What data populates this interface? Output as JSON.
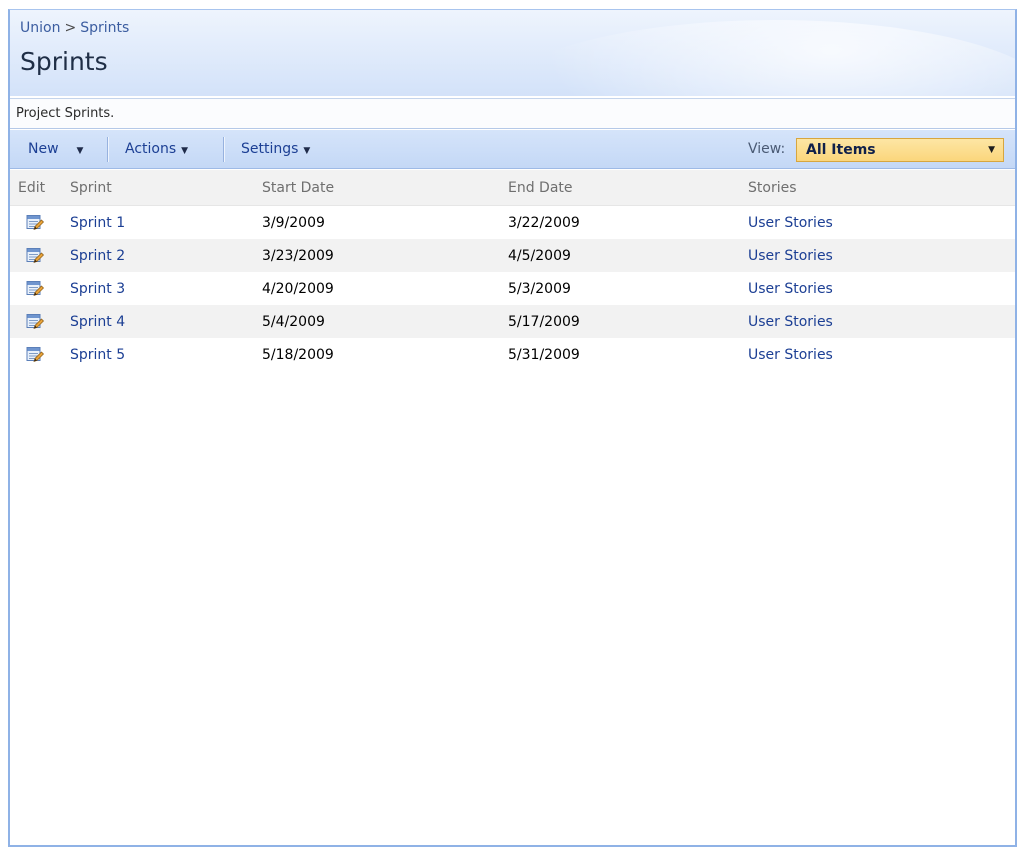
{
  "breadcrumb": {
    "site": "Union",
    "separator": ">",
    "current": "Sprints"
  },
  "page_title": "Sprints",
  "description": "Project Sprints.",
  "toolbar": {
    "new_label": "New",
    "actions_label": "Actions",
    "settings_label": "Settings",
    "view_label": "View:",
    "view_selected": "All Items"
  },
  "columns": {
    "edit": "Edit",
    "sprint": "Sprint",
    "start": "Start Date",
    "end": "End Date",
    "stories": "Stories"
  },
  "rows": [
    {
      "sprint": "Sprint 1",
      "start": "3/9/2009",
      "end": "3/22/2009",
      "stories": "User Stories"
    },
    {
      "sprint": "Sprint 2",
      "start": "3/23/2009",
      "end": "4/5/2009",
      "stories": "User Stories"
    },
    {
      "sprint": "Sprint 3",
      "start": "4/20/2009",
      "end": "5/3/2009",
      "stories": "User Stories"
    },
    {
      "sprint": "Sprint 4",
      "start": "5/4/2009",
      "end": "5/17/2009",
      "stories": "User Stories"
    },
    {
      "sprint": "Sprint 5",
      "start": "5/18/2009",
      "end": "5/31/2009",
      "stories": "User Stories"
    }
  ],
  "icons": {
    "edit": "edit-icon",
    "dropdown": "chevron-down-icon"
  },
  "colors": {
    "link": "#1c3f94",
    "toolbar": "#c4d8f6",
    "view_select": "#fbd67c"
  }
}
